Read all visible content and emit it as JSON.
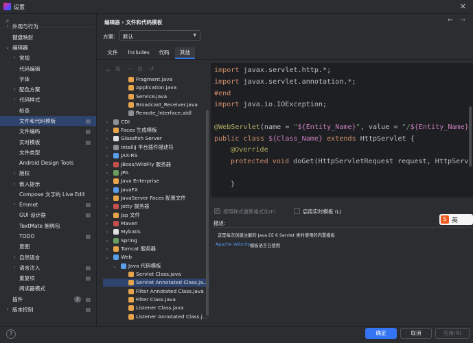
{
  "window": {
    "title": "设置",
    "close_icon": "close-icon"
  },
  "search": {
    "placeholder": ""
  },
  "sidebar": {
    "items": [
      {
        "label": "外观与行为",
        "arrow": "›"
      },
      {
        "label": "键盘映射",
        "arrow": ""
      },
      {
        "label": "编辑器",
        "arrow": "⌄"
      },
      {
        "label": "常规",
        "arrow": "›"
      },
      {
        "label": "代码编辑",
        "arrow": ""
      },
      {
        "label": "字体",
        "arrow": ""
      },
      {
        "label": "配色方案",
        "arrow": "›"
      },
      {
        "label": "代码样式",
        "arrow": "›"
      },
      {
        "label": "检查",
        "arrow": ""
      },
      {
        "label": "文件和代码模板",
        "arrow": ""
      },
      {
        "label": "文件编码",
        "arrow": ""
      },
      {
        "label": "实时模板",
        "arrow": ""
      },
      {
        "label": "文件类型",
        "arrow": ""
      },
      {
        "label": "Android Design Tools",
        "arrow": ""
      },
      {
        "label": "版权",
        "arrow": "›"
      },
      {
        "label": "嵌入提示",
        "arrow": "›"
      },
      {
        "label": "Compose 文字的 Live Edit",
        "arrow": ""
      },
      {
        "label": "Emmet",
        "arrow": "›"
      },
      {
        "label": "GUI 设计器",
        "arrow": ""
      },
      {
        "label": "TextMate 捆绑包",
        "arrow": ""
      },
      {
        "label": "TODO",
        "arrow": ""
      },
      {
        "label": "意图",
        "arrow": ""
      },
      {
        "label": "自然语言",
        "arrow": "›"
      },
      {
        "label": "语言注入",
        "arrow": "›"
      },
      {
        "label": "重复项",
        "arrow": ""
      },
      {
        "label": "阅读器模式",
        "arrow": ""
      },
      {
        "label": "插件",
        "arrow": ""
      },
      {
        "label": "版本控制",
        "arrow": "›"
      }
    ],
    "plugins_badge": "2"
  },
  "header": {
    "breadcrumb": "编辑器 › 文件和代码模板",
    "scheme_label": "方案:",
    "scheme_value": "默认"
  },
  "tabs": [
    {
      "label": "文件"
    },
    {
      "label": "Includes"
    },
    {
      "label": "代码"
    },
    {
      "label": "其他"
    }
  ],
  "templates": [
    {
      "label": "Fragment.java",
      "arrow": "",
      "color": "#e8a44a"
    },
    {
      "label": "Application.java",
      "arrow": "",
      "color": "#e8a44a"
    },
    {
      "label": "Service.java",
      "arrow": "",
      "color": "#e8a44a"
    },
    {
      "label": "Broadcast_Receiver.java",
      "arrow": "",
      "color": "#e8a44a"
    },
    {
      "label": "Remote_Interface.aidl",
      "arrow": "",
      "color": "#8c8f94"
    },
    {
      "label": "CDI",
      "arrow": "›",
      "color": "#8c8f94"
    },
    {
      "label": "Faces 生成模板",
      "arrow": "›",
      "color": "#e8a44a"
    },
    {
      "label": "Glassfish Server",
      "arrow": "›",
      "color": "#dfe1e5"
    },
    {
      "label": "IntelliJ 平台插件描述符",
      "arrow": "›",
      "color": "#8c8f94"
    },
    {
      "label": "JAX-RS",
      "arrow": "›",
      "color": "#5a9de8"
    },
    {
      "label": "JBoss/WildFly 服务器",
      "arrow": "›",
      "color": "#c94f4f"
    },
    {
      "label": "JPA",
      "arrow": "›",
      "color": "#6a9e5f"
    },
    {
      "label": "Java Enterprise",
      "arrow": "›",
      "color": "#e8a44a"
    },
    {
      "label": "JavaFX",
      "arrow": "›",
      "color": "#5a9de8"
    },
    {
      "label": "JavaServer Faces 配置文件",
      "arrow": "›",
      "color": "#e8a44a"
    },
    {
      "label": "Jetty 服务器",
      "arrow": "›",
      "color": "#c94f4f"
    },
    {
      "label": "Jsp 文件",
      "arrow": "›",
      "color": "#e8a44a"
    },
    {
      "label": "Maven",
      "arrow": "›",
      "color": "#c94f4f"
    },
    {
      "label": "Mybatis",
      "arrow": "›",
      "color": "#dfe1e5"
    },
    {
      "label": "Spring",
      "arrow": "›",
      "color": "#6a9e5f"
    },
    {
      "label": "Tomcat 服务器",
      "arrow": "›",
      "color": "#e8a44a"
    },
    {
      "label": "Web",
      "arrow": "⌄",
      "color": "#5a9de8"
    },
    {
      "label": "Java 代码模板",
      "arrow": "⌄",
      "color": "#5a9de8"
    },
    {
      "label": "Servlet Class.java",
      "arrow": "",
      "color": "#e8a44a"
    },
    {
      "label": "Servlet Annotated Class.ja...",
      "arrow": "",
      "color": "#e8a44a"
    },
    {
      "label": "Filter Annotated Class.java",
      "arrow": "",
      "color": "#e8a44a"
    },
    {
      "label": "Filter Class.java",
      "arrow": "",
      "color": "#e8a44a"
    },
    {
      "label": "Listener Class.java",
      "arrow": "",
      "color": "#e8a44a"
    },
    {
      "label": "Listener Annotated Class.j...",
      "arrow": "",
      "color": "#e8a44a"
    }
  ],
  "code": {
    "l1_kw": "import",
    "l1_rest": " javax.servlet.http.*;",
    "l2_kw": "import",
    "l2_rest": " javax.servlet.annotation.*;",
    "l3": "#end",
    "l4_kw": "import",
    "l4_rest": " java.io.IOException;",
    "l5_ann": "@WebServlet",
    "l5_a": "(name = ",
    "l5_s1": "\"",
    "l5_v1": "${Entity_Name}",
    "l5_s2": "\"",
    "l5_b": ", value = ",
    "l5_s3": "\"/",
    "l5_v2": "${Entity_Name}",
    "l5_s4": "\"",
    "l5_c": ")",
    "l6_kw1": "public class ",
    "l6_v": "${Class_Name}",
    "l6_kw2": " extends",
    "l6_rest": " HttpServlet {",
    "l7_ann": "@Override",
    "l8_kw": "protected void",
    "l8_rest": " doGet(HttpServletRequest request, HttpServle",
    "l9": "}"
  },
  "options": {
    "reformat_label": "按照样式重新格式化(F)",
    "live_template_label": "启用实时模板 (L)",
    "reformat_checked": true,
    "live_template_checked": false
  },
  "description": {
    "label": "描述:",
    "text": "这是每次创建注解的 Java EE 6 Servlet 类时使用的内置模板",
    "link": "Apache Velocity",
    "rest": " 模板语言已使用"
  },
  "ime": {
    "label": "英"
  },
  "footer": {
    "ok": "确定",
    "cancel": "取消",
    "apply": "应用(A)",
    "help": "?"
  }
}
